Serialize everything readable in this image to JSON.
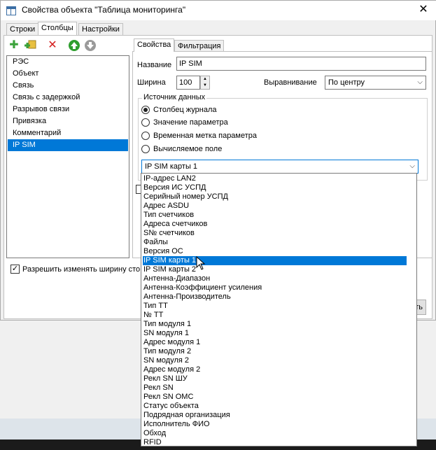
{
  "window": {
    "title": "Свойства объекта \"Таблица мониторинга\"",
    "close_glyph": "✕"
  },
  "outer_tabs": [
    {
      "label": "Строки",
      "active": false
    },
    {
      "label": "Столбцы",
      "active": true
    },
    {
      "label": "Настройки",
      "active": false
    }
  ],
  "toolbar_icons": [
    "add-icon",
    "add-copy-icon",
    "delete-icon",
    "move-up-icon",
    "move-down-icon"
  ],
  "columns_list": {
    "items": [
      "РЭС",
      "Объект",
      "Связь",
      "Связь с задержкой",
      "Разрывов связи",
      "Привязка",
      "Комментарий",
      "IP SIM"
    ],
    "selected": "IP SIM"
  },
  "inner_tabs": [
    {
      "label": "Свойства",
      "active": true
    },
    {
      "label": "Фильтрация",
      "active": false
    }
  ],
  "props": {
    "name_label": "Название",
    "name_value": "IP SIM",
    "width_label": "Ширина",
    "width_value": "100",
    "align_label": "Выравнивание",
    "align_value": "По центру"
  },
  "data_source": {
    "legend": "Источник данных",
    "options": [
      "Столбец журнала",
      "Значение параметра",
      "Временная метка параметра",
      "Вычисляемое поле"
    ],
    "selected": "Столбец журнала",
    "combo_value": "IP SIM карты 1"
  },
  "allow_resize": {
    "label": "Разрешить изменять ширину сто",
    "checked": true
  },
  "partial_button_text": "ть",
  "dropdown": {
    "items": [
      "IP-адрес LAN2",
      "Версия ИС УСПД",
      "Серийный номер УСПД",
      "Адрес ASDU",
      "Тип счетчиков",
      "Адреса счетчиков",
      "S№ счетчиков",
      "Файлы",
      "Версия ОС",
      "IP SIM карты 1",
      "IP SIM карты 2",
      "Антенна-Диапазон",
      "Антенна-Коэффициент усиления",
      "Антенна-Производитель",
      "Тип ТТ",
      "№ ТТ",
      "Тип модуля 1",
      "SN модуля 1",
      "Адрес модуля 1",
      "Тип модуля 2",
      "SN модуля 2",
      "Адрес модуля 2",
      "Рекл SN ШУ",
      "Рекл SN",
      "Рекл SN ОМС",
      "Статус объекта",
      "Подрядная организация",
      "Исполнитель ФИО",
      "Обход",
      "RFID"
    ],
    "highlighted": "IP SIM карты 1"
  },
  "colors": {
    "selection": "#0078d7",
    "add_green": "#3aa23a",
    "delete_red": "#d42020",
    "arrow_up_green": "#2e9e2e",
    "arrow_down_gray": "#9a9a9a"
  }
}
